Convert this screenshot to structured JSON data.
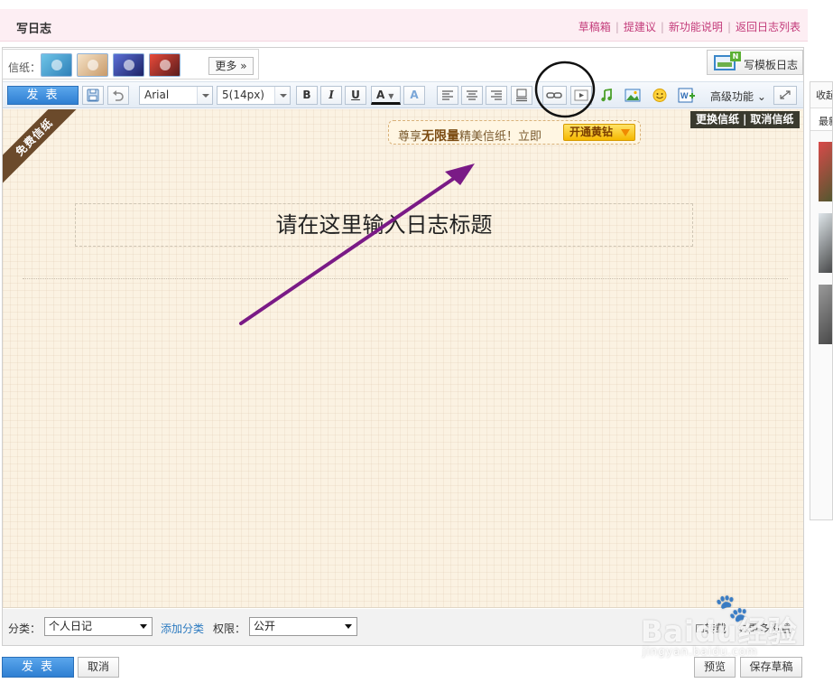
{
  "header": {
    "title": "写日志",
    "links": [
      "草稿箱",
      "提建议",
      "新功能说明",
      "返回日志列表"
    ]
  },
  "stationery": {
    "label": "信纸：",
    "more_label": "更多"
  },
  "template_button": {
    "badge": "N",
    "label": "写模板日志"
  },
  "toolbar": {
    "publish_label": "发 表",
    "font_family": "Arial",
    "font_size": "5(14px)",
    "bold": "B",
    "italic": "I",
    "underline": "U",
    "font_color": "A",
    "highlight": "A",
    "advanced_label": "高级功能"
  },
  "canvas": {
    "free_ribbon": "免费信纸",
    "promo_prefix": "尊享",
    "promo_bold": "无限量",
    "promo_suffix": "精美信纸！立即",
    "vip_button": "开通黄钻",
    "change_stationery": "更换信纸",
    "cancel_stationery": "取消信纸",
    "title_placeholder": "请在这里输入日志标题"
  },
  "options": {
    "category_label": "分类：",
    "category_value": "个人日记",
    "add_category": "添加分类",
    "permission_label": "权限：",
    "permission_value": "公开",
    "right_1": "转载",
    "right_2": "更多设置"
  },
  "footer": {
    "publish_label": "发 表",
    "cancel_label": "取消",
    "preview_label": "预览",
    "save_draft_label": "保存草稿"
  },
  "side_panel": {
    "title": "收起",
    "tab": "最新"
  },
  "watermark": {
    "text": "Baidu经验",
    "sub": "jingyan.baidu.com"
  },
  "colors": {
    "accent_blue": "#2f7fd2",
    "header_link": "#c33b7a",
    "annotation_arrow": "#7a1a86",
    "canvas_bg": "#fbf2e2"
  }
}
